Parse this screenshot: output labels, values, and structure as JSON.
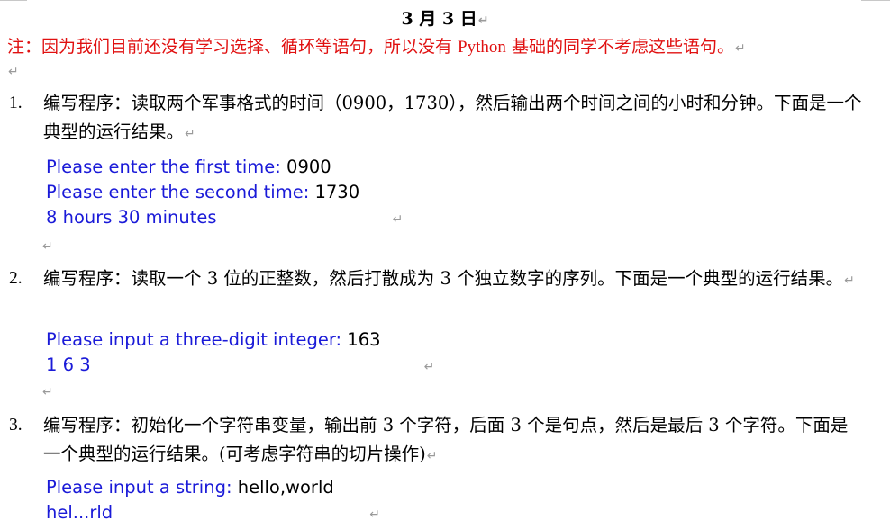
{
  "title": "3 月 3 日",
  "note": {
    "prefix": "注：因为我们目前还没有学习选择、循环等语句，所以没有 ",
    "python": "Python",
    "suffix": " 基础的同学不考虑这些语句。"
  },
  "items": [
    {
      "number": "1.",
      "text": "编写程序：读取两个军事格式的时间（0900，1730），然后输出两个时间之间的小时和分钟。下面是一个典型的运行结果。",
      "console": [
        {
          "prompt": "Please enter the first time: ",
          "input": "0900"
        },
        {
          "prompt": "Please enter the second time: ",
          "input": "1730"
        },
        {
          "output": "8 hours 30 minutes"
        }
      ]
    },
    {
      "number": "2.",
      "text": "编写程序：读取一个 3 位的正整数，然后打散成为 3 个独立数字的序列。下面是一个典型的运行结果。",
      "console": [
        {
          "prompt": "Please input a three-digit integer: ",
          "input": "163"
        },
        {
          "output": "1 6 3"
        }
      ]
    },
    {
      "number": "3.",
      "text": "编写程序：初始化一个字符串变量，输出前 3 个字符，后面 3 个是句点，然后是最后 3 个字符。下面是一个典型的运行结果。(可考虑字符串的切片操作)",
      "console": [
        {
          "prompt": "Please input a string: ",
          "input": "hello,world"
        },
        {
          "output": "hel...rld"
        }
      ]
    }
  ],
  "paragraph_mark": "↵"
}
